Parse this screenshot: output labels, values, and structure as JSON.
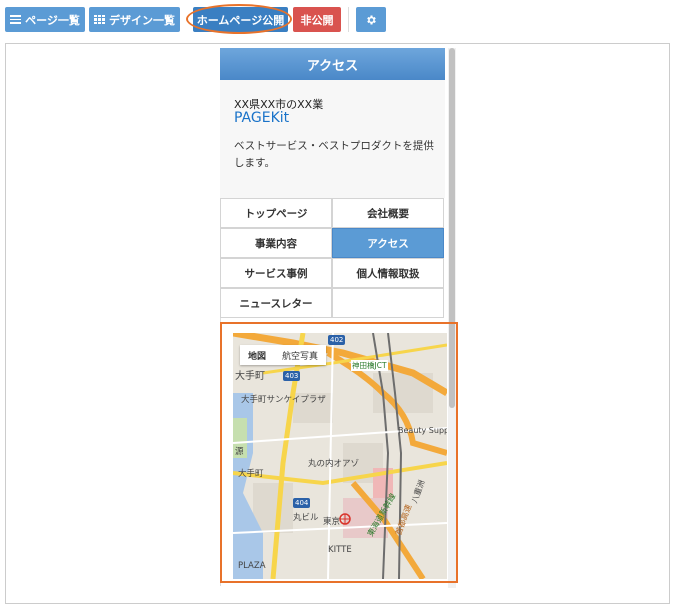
{
  "toolbar": {
    "pages_label": "ページ一覧",
    "design_label": "デザイン一覧",
    "publish_label": "ホームページ公開",
    "unpublish_label": "非公開"
  },
  "preview": {
    "header_title": "アクセス",
    "address": "XX県XX市のXX業",
    "brand": "PAGEKit",
    "description": "ベストサービス・ベストプロダクトを提供します。",
    "nav": [
      {
        "label": "トップページ"
      },
      {
        "label": "会社概要"
      },
      {
        "label": "事業内容"
      },
      {
        "label": "アクセス"
      },
      {
        "label": "サービス事例"
      },
      {
        "label": "個人情報取扱"
      },
      {
        "label": "ニュースレター"
      },
      {
        "label": ""
      }
    ],
    "active_nav": "アクセス"
  },
  "map": {
    "tab_map": "地図",
    "tab_satellite": "航空写真",
    "labels": {
      "jct": "神田橋JCT",
      "otemachi": "大手町",
      "sankei": "大手町サンケイプラザ",
      "beauty": "Beauty Supply St",
      "oazo": "丸の内オアゾ",
      "marubiru": "丸ビル",
      "tokyo": "東京",
      "kitte": "KITTE",
      "plaza": "PLAZA",
      "tokaido": "東海道新幹線",
      "yaesu": "八重洲",
      "shuto": "首都高速",
      "genji": "源"
    },
    "route_numbers": [
      "402",
      "403",
      "404"
    ]
  },
  "colors": {
    "accent_blue": "#5b9bd5",
    "danger_red": "#d9534f",
    "highlight_orange": "#e8722a",
    "brand_link": "#1a73c9"
  }
}
